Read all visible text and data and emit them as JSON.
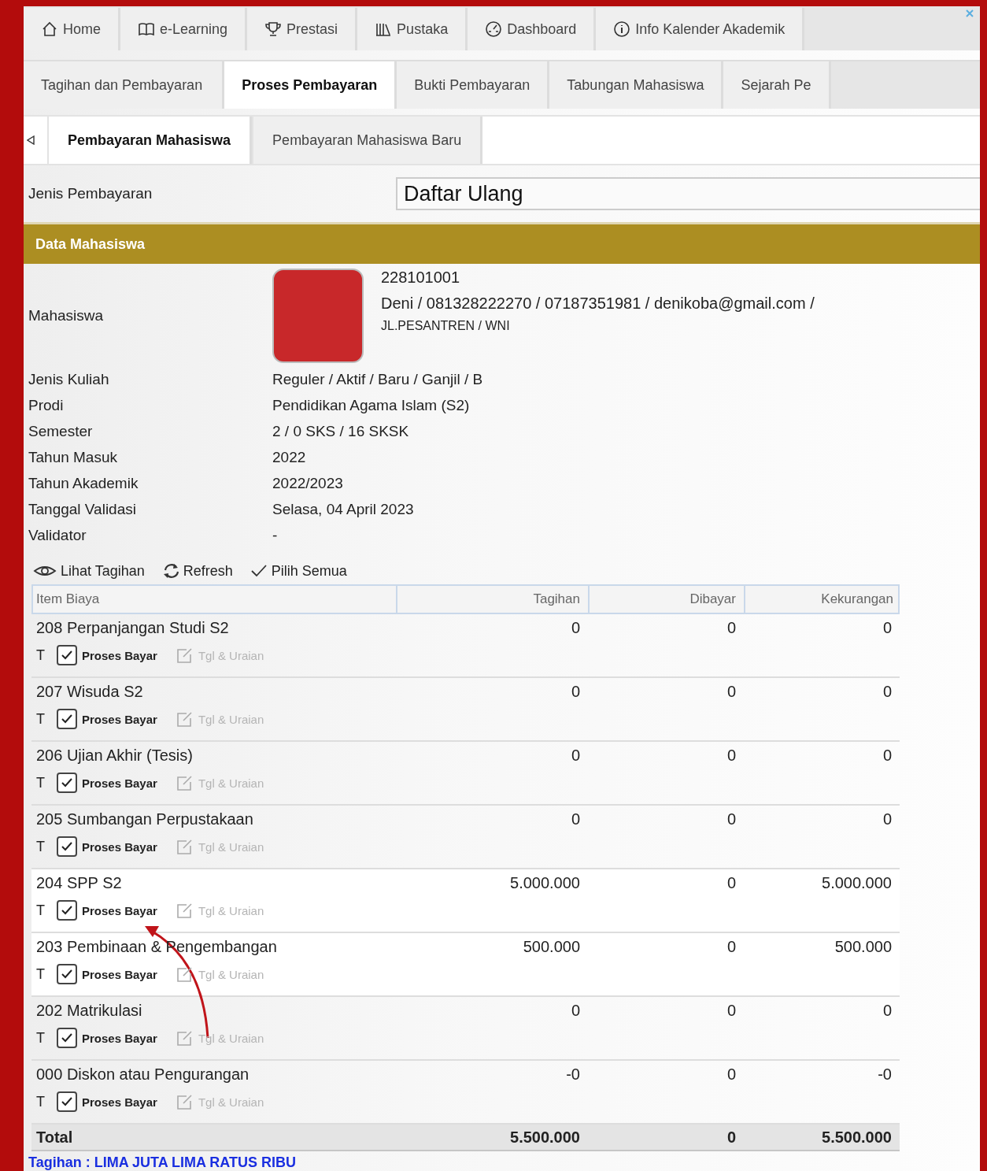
{
  "main_tabs": [
    {
      "label": "Home",
      "selected": false
    },
    {
      "label": "e-Learning",
      "selected": false
    },
    {
      "label": "Prestasi",
      "selected": false
    },
    {
      "label": "Pustaka",
      "selected": false
    },
    {
      "label": "Dashboard",
      "selected": false
    },
    {
      "label": "Info Kalender Akademik",
      "selected": false
    }
  ],
  "sub_tabs": [
    {
      "label": "Tagihan dan Pembayaran",
      "selected": false
    },
    {
      "label": "Proses Pembayaran",
      "selected": true
    },
    {
      "label": "Bukti Pembayaran",
      "selected": false
    },
    {
      "label": "Tabungan Mahasiswa",
      "selected": false
    },
    {
      "label": "Sejarah Pe",
      "selected": false
    }
  ],
  "page_tabs": [
    {
      "label": "Pembayaran Mahasiswa",
      "selected": true
    },
    {
      "label": "Pembayaran Mahasiswa Baru",
      "selected": false
    }
  ],
  "payment_type": {
    "label": "Jenis Pembayaran",
    "value": "Daftar Ulang"
  },
  "section_title": "Data Mahasiswa",
  "student": {
    "label": "Mahasiswa",
    "nim": "228101001",
    "contact": "Deni / 081328222270 / 07187351981 / denikoba@gmail.com /",
    "address": "JL.PESANTREN / WNI"
  },
  "details": [
    {
      "label": "Jenis Kuliah",
      "value": "Reguler / Aktif / Baru / Ganjil / B"
    },
    {
      "label": "Prodi",
      "value": "Pendidikan Agama Islam (S2)"
    },
    {
      "label": "Semester",
      "value": "2 / 0 SKS / 16 SKSK"
    },
    {
      "label": "Tahun Masuk",
      "value": "2022"
    },
    {
      "label": "Tahun Akademik",
      "value": "2022/2023"
    },
    {
      "label": "Tanggal Validasi",
      "value": "Selasa, 04 April 2023"
    },
    {
      "label": "Validator",
      "value": "-"
    }
  ],
  "toolbar": [
    {
      "label": "Lihat Tagihan"
    },
    {
      "label": "Refresh"
    },
    {
      "label": "Pilih Semua"
    }
  ],
  "table": {
    "columns": [
      "Item Biaya",
      "Tagihan",
      "Dibayar",
      "Kekurangan"
    ],
    "rows": [
      {
        "item": "208 Perpanjangan Studi S2",
        "tagihan": "0",
        "dibayar": "0",
        "kekurangan": "0",
        "type": "T",
        "action": "Proses Bayar",
        "checked": true,
        "detail": "Tgl & Uraian",
        "highlighted": false
      },
      {
        "item": "207 Wisuda S2",
        "tagihan": "0",
        "dibayar": "0",
        "kekurangan": "0",
        "type": "T",
        "action": "Proses Bayar",
        "checked": true,
        "detail": "Tgl & Uraian",
        "highlighted": false
      },
      {
        "item": "206 Ujian Akhir (Tesis)",
        "tagihan": "0",
        "dibayar": "0",
        "kekurangan": "0",
        "type": "T",
        "action": "Proses Bayar",
        "checked": true,
        "detail": "Tgl & Uraian",
        "highlighted": false
      },
      {
        "item": "205 Sumbangan Perpustakaan",
        "tagihan": "0",
        "dibayar": "0",
        "kekurangan": "0",
        "type": "T",
        "action": "Proses Bayar",
        "checked": true,
        "detail": "Tgl & Uraian",
        "highlighted": false
      },
      {
        "item": "204 SPP S2",
        "tagihan": "5.000.000",
        "dibayar": "0",
        "kekurangan": "5.000.000",
        "type": "T",
        "action": "Proses Bayar",
        "checked": true,
        "detail": "Tgl & Uraian",
        "highlighted": true
      },
      {
        "item": "203 Pembinaan & Pengembangan",
        "tagihan": "500.000",
        "dibayar": "0",
        "kekurangan": "500.000",
        "type": "T",
        "action": "Proses Bayar",
        "checked": true,
        "detail": "Tgl & Uraian",
        "highlighted": true
      },
      {
        "item": "202 Matrikulasi",
        "tagihan": "0",
        "dibayar": "0",
        "kekurangan": "0",
        "type": "T",
        "action": "Proses Bayar",
        "checked": true,
        "detail": "Tgl & Uraian",
        "highlighted": false
      },
      {
        "item": "000 Diskon atau Pengurangan",
        "tagihan": "-0",
        "dibayar": "0",
        "kekurangan": "-0",
        "type": "T",
        "action": "Proses Bayar",
        "checked": true,
        "detail": "Tgl & Uraian",
        "highlighted": false
      }
    ],
    "total": {
      "label": "Total",
      "tagihan": "5.500.000",
      "dibayar": "0",
      "kekurangan": "5.500.000"
    }
  },
  "amount_in_words": "Tagihan : LIMA JUTA LIMA RATUS RIBU"
}
